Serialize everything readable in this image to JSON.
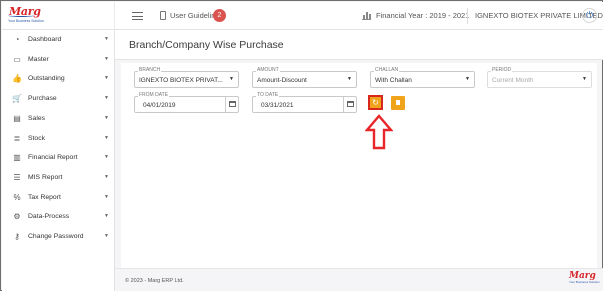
{
  "brand": {
    "logo": "Marg",
    "tagline": "Your Business Solution"
  },
  "topbar": {
    "menu_icon": "hamburger-icon",
    "user_guideline": "User Guideline",
    "guideline_badge": "2",
    "financial_year": "Financial Year : 2019 - 2021",
    "company": "IGNEXTO BIOTEX PRIVATE LIMITED",
    "power_icon": "power-icon"
  },
  "sidebar": {
    "items": [
      {
        "label": "Dashboard",
        "icon": "dashboard-icon",
        "glyph": "◔"
      },
      {
        "label": "Master",
        "icon": "master-icon",
        "glyph": "▭"
      },
      {
        "label": "Outstanding",
        "icon": "thumbs-up-icon",
        "glyph": "👍"
      },
      {
        "label": "Purchase",
        "icon": "cart-icon",
        "glyph": "🛒"
      },
      {
        "label": "Sales",
        "icon": "sales-icon",
        "glyph": "▤"
      },
      {
        "label": "Stock",
        "icon": "stock-icon",
        "glyph": "≣"
      },
      {
        "label": "Financial Report",
        "icon": "report-icon",
        "glyph": "▥"
      },
      {
        "label": "MIS Report",
        "icon": "mis-report-icon",
        "glyph": "☰"
      },
      {
        "label": "Tax Report",
        "icon": "percent-icon",
        "glyph": "%"
      },
      {
        "label": "Data-Process",
        "icon": "data-process-icon",
        "glyph": "⚙"
      },
      {
        "label": "Change Password",
        "icon": "key-icon",
        "glyph": "⚷"
      }
    ]
  },
  "page": {
    "title": "Branch/Company Wise Purchase"
  },
  "form": {
    "branch": {
      "label": "BRANCH",
      "value": "IGNEXTO BIOTEX PRIVAT..."
    },
    "amount": {
      "label": "AMOUNT",
      "value": "Amount-Discount"
    },
    "challan": {
      "label": "CHALLAN",
      "value": "With Challan"
    },
    "period": {
      "label": "PERIOD",
      "placeholder": "Current Month"
    },
    "from_date": {
      "label": "FROM DATE",
      "value": "04/01/2019"
    },
    "to_date": {
      "label": "TO DATE",
      "value": "03/31/2021"
    }
  },
  "buttons": {
    "refresh_icon": "refresh-icon",
    "refresh_glyph": "↻",
    "document_icon": "document-icon"
  },
  "colors": {
    "accent": "#f0a41c",
    "highlight": "#d8281e",
    "brand_red": "#d6262a"
  },
  "footer": {
    "copyright": "© 2023 - Marg ERP Ltd.",
    "logo": "Marg",
    "tagline": "Your Business Solution"
  }
}
